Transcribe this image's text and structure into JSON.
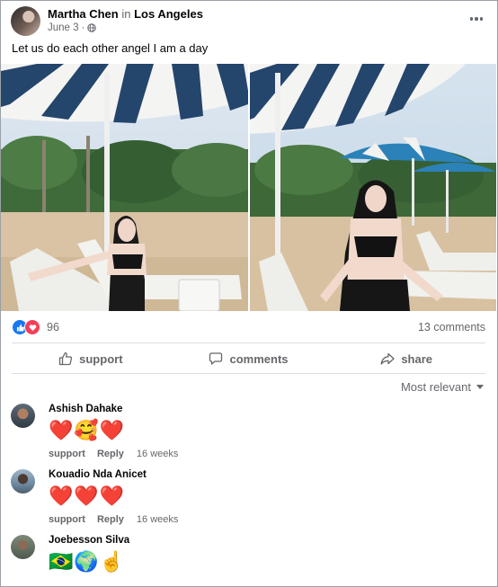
{
  "post": {
    "author": "Martha Chen",
    "in_word": "in",
    "location": "Los Angeles",
    "date": "June 3",
    "dot": "·",
    "caption": "Let us do each other angel I am a day"
  },
  "photos": [
    {
      "name": "beach-photo-left"
    },
    {
      "name": "beach-photo-right"
    }
  ],
  "stats": {
    "reaction_count": "96",
    "comments": "13 comments"
  },
  "actions": {
    "support": "support",
    "comments": "comments",
    "share": "share"
  },
  "sort": {
    "label": "Most relevant"
  },
  "comments": [
    {
      "name": "Ashish Dahake",
      "body": "❤️🥰❤️",
      "support": "support",
      "reply": "Reply",
      "time": "16 weeks"
    },
    {
      "name": "Kouadio Nda Anicet",
      "body": "❤️❤️❤️",
      "support": "support",
      "reply": "Reply",
      "time": "16 weeks"
    },
    {
      "name": "Joebesson Silva",
      "body": "🇧🇷🌍☝️",
      "support": "",
      "reply": "",
      "time": ""
    }
  ],
  "colors": {
    "accent": "#1877f2",
    "love": "#f33e58",
    "secondary_text": "#65676b"
  }
}
